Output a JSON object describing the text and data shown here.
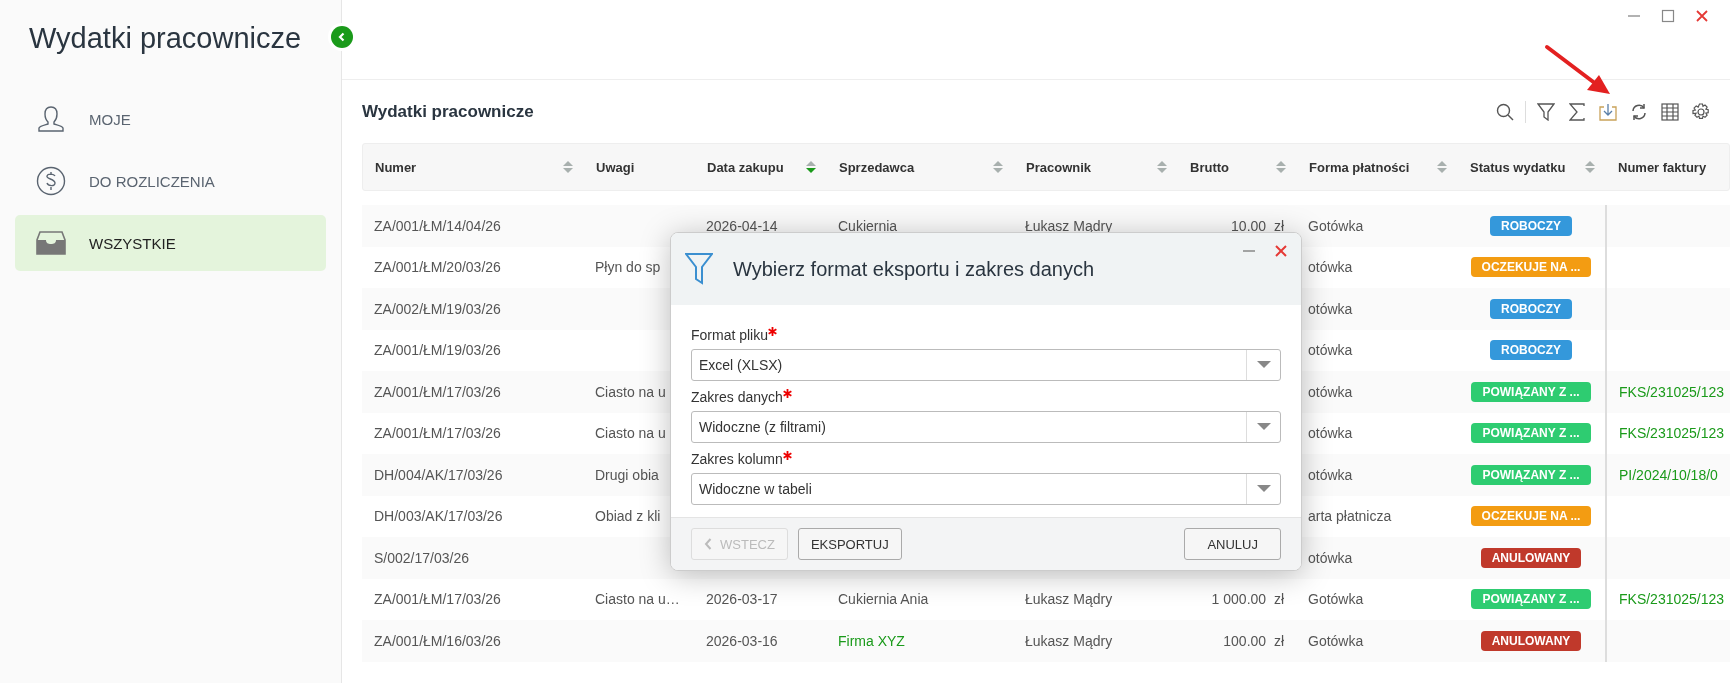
{
  "sidebar": {
    "title": "Wydatki pracownicze",
    "items": [
      {
        "label": "MOJE",
        "kind": "person",
        "selected": false
      },
      {
        "label": "DO ROZLICZENIA",
        "kind": "dollar",
        "selected": false
      },
      {
        "label": "WSZYSTKIE",
        "kind": "tray",
        "selected": true
      }
    ]
  },
  "section_title": "Wydatki pracownicze",
  "table": {
    "columns": [
      {
        "label": "Numer",
        "sortable": true,
        "sorted": false
      },
      {
        "label": "Uwagi",
        "sortable": false
      },
      {
        "label": "Data zakupu",
        "sortable": true,
        "sorted": true
      },
      {
        "label": "Sprzedawca",
        "sortable": true,
        "sorted": false
      },
      {
        "label": "Pracownik",
        "sortable": true,
        "sorted": false
      },
      {
        "label": "Brutto",
        "sortable": true,
        "sorted": false
      },
      {
        "label": "Forma płatności",
        "sortable": true,
        "sorted": false
      },
      {
        "label": "Status wydatku",
        "sortable": true,
        "sorted": false
      },
      {
        "label": "Numer faktury",
        "sortable": false
      }
    ],
    "rows": [
      {
        "number": "ZA/001/ŁM/14/04/26",
        "date": "2026-04-14",
        "vendor": {
          "text": "Cukiernia",
          "link": false
        },
        "employee": "Łukasz Mądry",
        "gross": "10.00  zł",
        "payment": "Gotówka",
        "status": {
          "label": "ROBOCZY",
          "color": "#3498db"
        }
      },
      {
        "number": "ZA/001/ŁM/20/03/26",
        "note": "Płyn do sp",
        "payment": "otówka",
        "status": {
          "label": "OCZEKUJE NA ...",
          "color": "#f39c12"
        }
      },
      {
        "number": "ZA/002/ŁM/19/03/26",
        "payment": "otówka",
        "status": {
          "label": "ROBOCZY",
          "color": "#3498db"
        }
      },
      {
        "number": "ZA/001/ŁM/19/03/26",
        "payment": "otówka",
        "status": {
          "label": "ROBOCZY",
          "color": "#3498db"
        }
      },
      {
        "number": "ZA/001/ŁM/17/03/26",
        "note": "Ciasto na u",
        "payment": "otówka",
        "status": {
          "label": "POWIĄZANY Z ...",
          "color": "#2ecc71"
        },
        "invoice": "FKS/231025/123"
      },
      {
        "number": "ZA/001/ŁM/17/03/26",
        "note": "Ciasto na u",
        "payment": "otówka",
        "status": {
          "label": "POWIĄZANY Z ...",
          "color": "#2ecc71"
        },
        "invoice": "FKS/231025/123"
      },
      {
        "number": "DH/004/AK/17/03/26",
        "note": "Drugi obia",
        "payment": "otówka",
        "status": {
          "label": "POWIĄZANY Z ...",
          "color": "#2ecc71"
        },
        "invoice": "PI/2024/10/18/0"
      },
      {
        "number": "DH/003/AK/17/03/26",
        "note": "Obiad z kli",
        "payment": "arta płatnicza",
        "status": {
          "label": "OCZEKUJE NA ...",
          "color": "#f39c12"
        }
      },
      {
        "number": "S/002/17/03/26",
        "payment": "otówka",
        "status": {
          "label": "ANULOWANY",
          "color": "#c0392b"
        }
      },
      {
        "number": "ZA/001/ŁM/17/03/26",
        "note": "Ciasto na u…",
        "date": "2026-03-17",
        "vendor": {
          "text": "Cukiernia Ania",
          "link": false
        },
        "employee": "Łukasz Mądry",
        "gross": "1 000.00  zł",
        "payment": "Gotówka",
        "status": {
          "label": "POWIĄZANY Z ...",
          "color": "#2ecc71"
        },
        "invoice": "FKS/231025/123"
      },
      {
        "number": "ZA/001/ŁM/16/03/26",
        "date": "2026-03-16",
        "vendor": {
          "text": "Firma XYZ",
          "link": true
        },
        "employee": "Łukasz Mądry",
        "gross": "100.00  zł",
        "payment": "Gotówka",
        "status": {
          "label": "ANULOWANY",
          "color": "#c0392b"
        }
      }
    ]
  },
  "dialog": {
    "title": "Wybierz format eksportu i zakres danych",
    "fields": [
      {
        "label": "Format pliku",
        "required": true,
        "value": "Excel (XLSX)"
      },
      {
        "label": "Zakres danych",
        "required": true,
        "value": "Widoczne (z filtrami)"
      },
      {
        "label": "Zakres kolumn",
        "required": true,
        "value": "Widoczne w tabeli"
      }
    ],
    "buttons": [
      {
        "label": "WSTECZ",
        "disabled": true,
        "kind": "back"
      },
      {
        "label": "EKSPORTUJ",
        "disabled": false,
        "kind": "plain"
      },
      {
        "label": "ANULUJ",
        "disabled": false,
        "kind": "cancel"
      }
    ]
  }
}
